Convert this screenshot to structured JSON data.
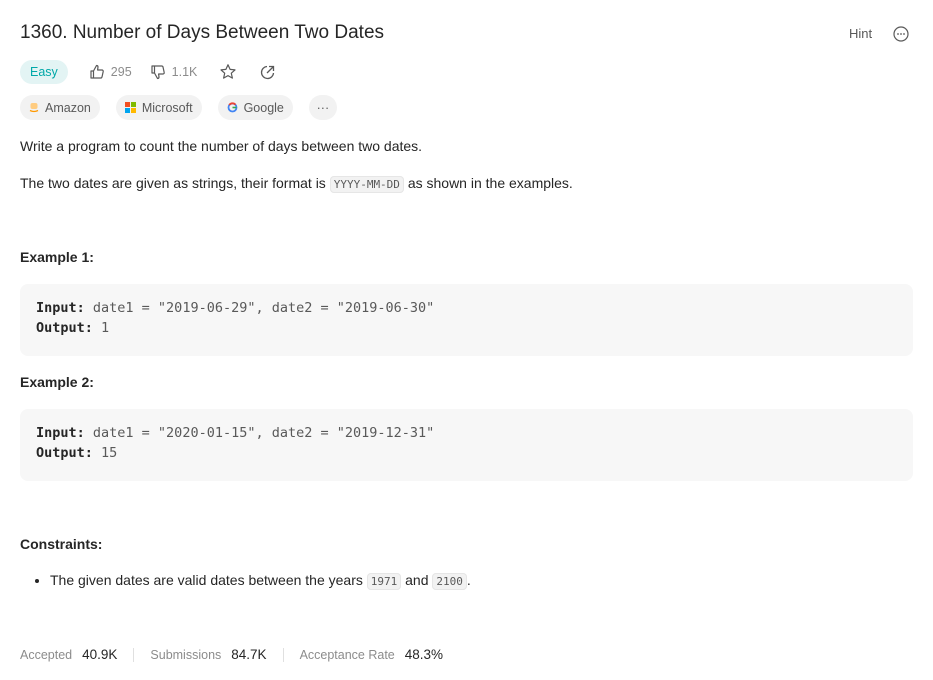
{
  "problem": {
    "title": "1360. Number of Days Between Two Dates",
    "hint_label": "Hint",
    "difficulty": "Easy",
    "likes": "295",
    "dislikes": "1.1K"
  },
  "companies": [
    {
      "name": "Amazon"
    },
    {
      "name": "Microsoft"
    },
    {
      "name": "Google"
    }
  ],
  "more_tags": "···",
  "description": {
    "p1": "Write a program to count the number of days between two dates.",
    "p2_before": "The two dates are given as strings, their format is ",
    "p2_code": "YYYY-MM-DD",
    "p2_after": " as shown in the examples."
  },
  "examples": [
    {
      "heading": "Example 1:",
      "input_label": "Input:",
      "input": " date1 = \"2019-06-29\", date2 = \"2019-06-30\"",
      "output_label": "Output:",
      "output": " 1"
    },
    {
      "heading": "Example 2:",
      "input_label": "Input:",
      "input": " date1 = \"2020-01-15\", date2 = \"2019-12-31\"",
      "output_label": "Output:",
      "output": " 15"
    }
  ],
  "constraints": {
    "heading": "Constraints:",
    "text_before": "The given dates are valid dates between the years ",
    "code1": "1971",
    "text_mid": " and ",
    "code2": "2100",
    "text_after": "."
  },
  "stats": {
    "accepted_label": "Accepted",
    "accepted": "40.9K",
    "submissions_label": "Submissions",
    "submissions": "84.7K",
    "rate_label": "Acceptance Rate",
    "rate": "48.3%"
  },
  "colors": {
    "easy": "#00a8a8",
    "easy_bg": "#e3f4f4",
    "code_bg": "#f7f7f7"
  }
}
